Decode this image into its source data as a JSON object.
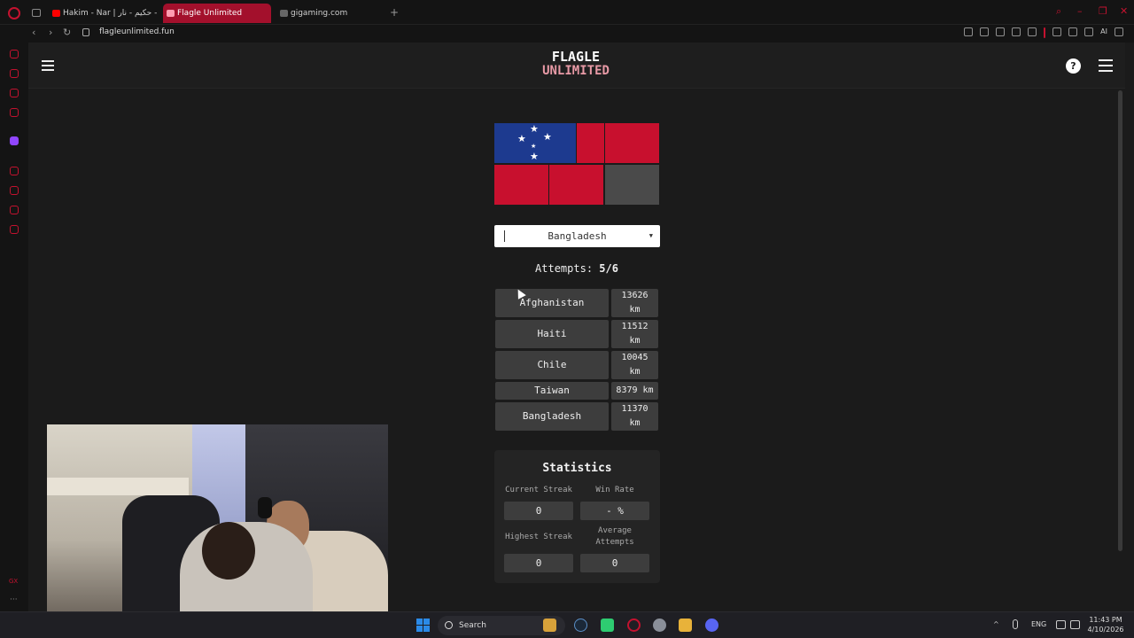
{
  "browser": {
    "tabs": [
      {
        "label": "Hakim - Nar | حكيم - نار - Yo",
        "active": false,
        "favicon_color": "#ff0000"
      },
      {
        "label": "Flagle Unlimited",
        "active": true,
        "favicon_color": "#ff9cb0"
      },
      {
        "label": "gigaming.com",
        "active": false,
        "favicon_color": "#666666"
      }
    ],
    "url": "flagleunlimited.fun",
    "ai_label": "AI"
  },
  "site": {
    "logo_line1": "FLAGLE",
    "logo_line2": "UNLIMITED",
    "help_label": "?"
  },
  "flag": {
    "colors": {
      "red": "#c8102e",
      "blue": "#1d3a8f",
      "hidden": "#4a4a4a"
    },
    "tiles_revealed": 5,
    "tiles_total": 6
  },
  "guess_input": {
    "selected_value": "Bangladesh"
  },
  "attempts": {
    "label": "Attempts:",
    "value": "5/6"
  },
  "guesses": [
    {
      "country": "Afghanistan",
      "distance_line1": "13626",
      "distance_line2": "km"
    },
    {
      "country": "Haiti",
      "distance_line1": "11512",
      "distance_line2": "km"
    },
    {
      "country": "Chile",
      "distance_line1": "10045",
      "distance_line2": "km"
    },
    {
      "country": "Taiwan",
      "distance_line1": "8379 km",
      "distance_line2": ""
    },
    {
      "country": "Bangladesh",
      "distance_line1": "11370",
      "distance_line2": "km"
    }
  ],
  "statistics": {
    "title": "Statistics",
    "current_streak_label": "Current Streak",
    "current_streak": "0",
    "win_rate_label": "Win Rate",
    "win_rate": "- %",
    "highest_streak_label": "Highest Streak",
    "highest_streak": "0",
    "average_attempts_label_line1": "Average",
    "average_attempts_label_line2": "Attempts",
    "average_attempts": "0"
  },
  "taskbar": {
    "search_label": "Search",
    "language": "ENG",
    "time": "11:43 PM",
    "date": "4/10/2026"
  },
  "sidebar": {
    "gx_label": "GX",
    "more_label": "···"
  }
}
